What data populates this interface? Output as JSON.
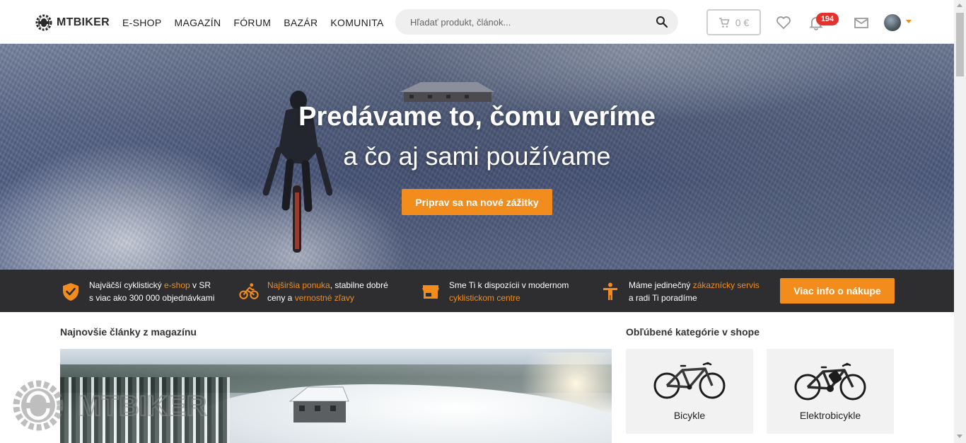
{
  "header": {
    "logo_text": "MTBIKER",
    "nav": [
      "E-SHOP",
      "MAGAZÍN",
      "FÓRUM",
      "BAZÁR",
      "KOMUNITA"
    ],
    "search_placeholder": "Hľadať produkt, článok...",
    "cart_total": "0 €",
    "notifications_count": "194",
    "icons": [
      "search-icon",
      "cart-icon",
      "heart-icon",
      "bell-icon",
      "mail-icon",
      "avatar"
    ]
  },
  "hero": {
    "title": "Predávame to, čomu veríme",
    "subtitle": "a čo aj sami používame",
    "cta": "Priprav sa na nové zážitky"
  },
  "infobar": {
    "items": [
      {
        "icon": "shield-check-icon",
        "line1_pre": "Najväčší cyklistický ",
        "line1_hl": "e-shop",
        "line1_post": " v SR",
        "line2": "s viac ako 300 000 objednávkami"
      },
      {
        "icon": "cyclist-icon",
        "line1_hl": "Najširšia ponuka",
        "line1_post": ", stabilne dobré",
        "line2_pre": "ceny a ",
        "line2_hl": "vernostné zľavy"
      },
      {
        "icon": "store-icon",
        "line1": "Sme Ti k dispozícii v modernom",
        "line2_hl": "cyklistickom centre"
      },
      {
        "icon": "person-icon",
        "line1_pre": "Máme jedinečný ",
        "line1_hl": "zákaznícky servis",
        "line2": "a radi Ti poradíme"
      }
    ],
    "button": "Viac info o nákupe",
    "accent": "#f28c1d"
  },
  "magazine": {
    "title": "Najnovšie články z magazínu"
  },
  "shop_categories": {
    "title": "Obľúbené kategórie v shope",
    "items": [
      "Bicykle",
      "Elektrobicykle"
    ]
  },
  "watermark_text": "MTBIKER",
  "colors": {
    "accent": "#f28c1d",
    "badge": "#e5322d",
    "infobar_bg": "#2e2e30"
  }
}
